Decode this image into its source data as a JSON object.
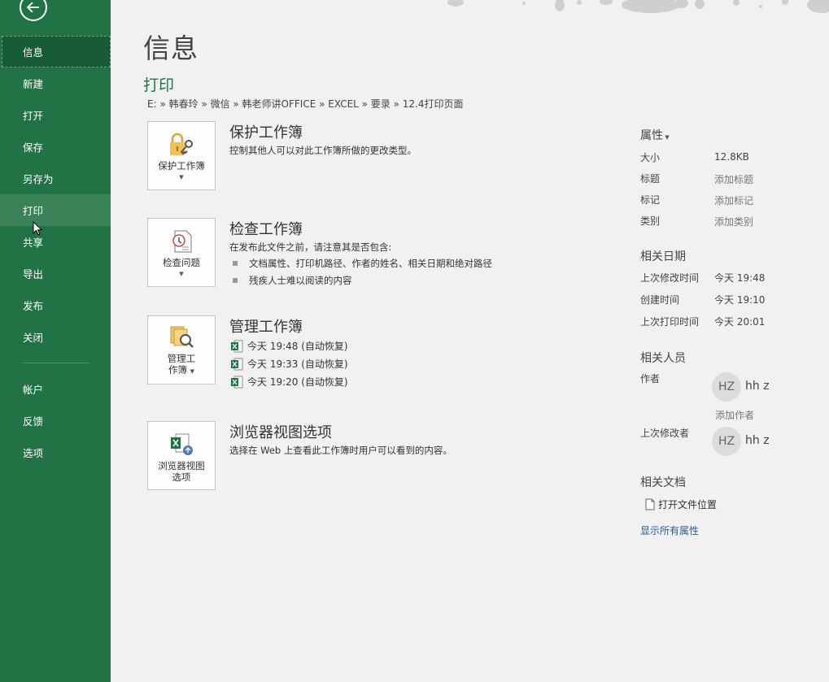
{
  "sidebar": {
    "items": [
      {
        "label": "信息"
      },
      {
        "label": "新建"
      },
      {
        "label": "打开"
      },
      {
        "label": "保存"
      },
      {
        "label": "另存为"
      },
      {
        "label": "打印"
      },
      {
        "label": "共享"
      },
      {
        "label": "导出"
      },
      {
        "label": "发布"
      },
      {
        "label": "关闭"
      }
    ],
    "lower_items": [
      {
        "label": "帐户"
      },
      {
        "label": "反馈"
      },
      {
        "label": "选项"
      }
    ]
  },
  "main": {
    "title": "信息",
    "file_name": "打印",
    "breadcrumb": "E: » 韩春玲 » 微信 » 韩老师讲OFFICE » EXCEL » 要录 » 12.4打印页面",
    "sections": {
      "protect": {
        "button_label": "保护工作簿",
        "title": "保护工作簿",
        "desc": "控制其他人可以对此工作簿所做的更改类型。"
      },
      "inspect": {
        "button_label": "检查问题",
        "title": "检查工作簿",
        "desc": "在发布此文件之前，请注意其是否包含:",
        "bullets": [
          "文档属性、打印机路径、作者的姓名、相关日期和绝对路径",
          "残疾人士难以阅读的内容"
        ]
      },
      "manage": {
        "button_label_1": "管理工",
        "button_label_2": "作簿",
        "title": "管理工作簿",
        "versions": [
          "今天 19:48 (自动恢复)",
          "今天 19:33 (自动恢复)",
          "今天 19:20 (自动恢复)"
        ]
      },
      "browser": {
        "button_label_1": "浏览器视图",
        "button_label_2": "选项",
        "title": "浏览器视图选项",
        "desc": "选择在 Web 上查看此工作簿时用户可以看到的内容。"
      }
    }
  },
  "properties": {
    "heading": "属性",
    "rows": [
      {
        "label": "大小",
        "value": "12.8KB"
      },
      {
        "label": "标题",
        "value": "添加标题"
      },
      {
        "label": "标记",
        "value": "添加标记"
      },
      {
        "label": "类别",
        "value": "添加类别"
      }
    ],
    "dates_heading": "相关日期",
    "dates": [
      {
        "label": "上次修改时间",
        "value": "今天 19:48"
      },
      {
        "label": "创建时间",
        "value": "今天 19:10"
      },
      {
        "label": "上次打印时间",
        "value": "今天 20:01"
      }
    ],
    "people_heading": "相关人员",
    "author_label": "作者",
    "author_initials": "HZ",
    "author_name": "hh z",
    "add_author": "添加作者",
    "modifier_label": "上次修改者",
    "modifier_initials": "HZ",
    "modifier_name": "hh z",
    "docs_heading": "相关文档",
    "open_location": "打开文件位置",
    "show_all": "显示所有属性"
  },
  "colors": {
    "sidebar": "#217346",
    "sidebar_active": "#185c37",
    "accent": "#217346",
    "link": "#2b579a"
  }
}
